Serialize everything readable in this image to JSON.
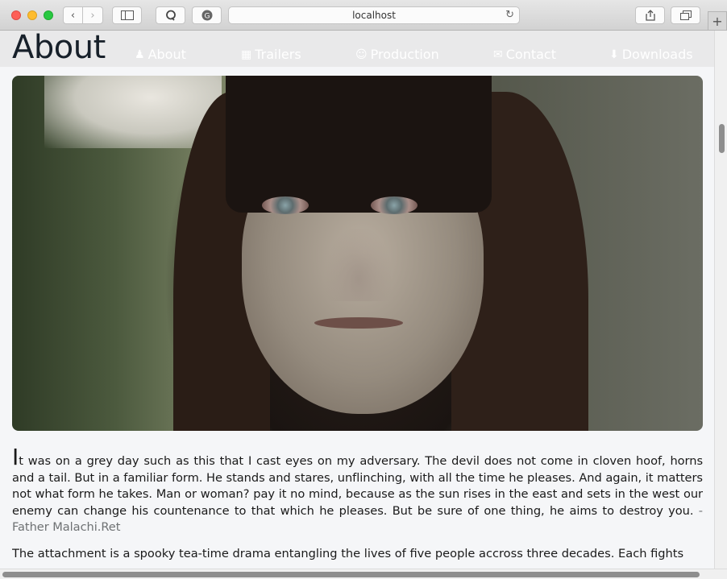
{
  "browser": {
    "url": "localhost",
    "new_tab_label": "+"
  },
  "site": {
    "page_title": "About",
    "nav": [
      {
        "label": "About",
        "icon": "users-icon"
      },
      {
        "label": "Trailers",
        "icon": "film-icon"
      },
      {
        "label": "Production",
        "icon": "mask-icon"
      },
      {
        "label": "Contact",
        "icon": "envelope-icon"
      },
      {
        "label": "Downloads",
        "icon": "download-icon"
      }
    ]
  },
  "hero_image": {
    "alt": "hero-photo"
  },
  "story": {
    "drop_cap": "I",
    "quote": "t was on a grey day such as this that I cast eyes on my adversary. The devil does not come in cloven hoof, horns and a tail. But in a familiar form. He stands and stares, unflinching, with all the time he pleases. And again, it mat­ters not what form he takes. Man or woman? pay it no mind, because as the sun rises in the east and sets in the west our enemy can change his countenance to that which he pleases. But be sure of one thing, he aims to destroy you.",
    "author": " - Father Malachi.Ret",
    "synopsis": "The attachment is a spooky tea-time drama entangling the lives of five people accross three decades. Each fights"
  }
}
